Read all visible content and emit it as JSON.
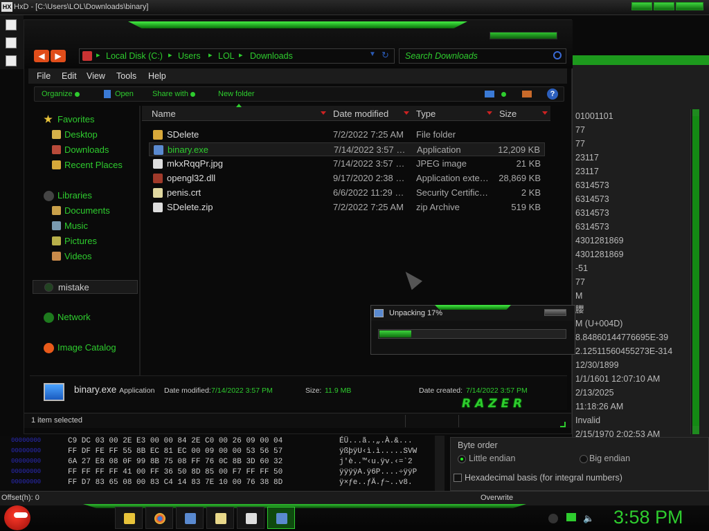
{
  "hxd": {
    "title": "HxD - [C:\\Users\\LOL\\Downloads\\binary]",
    "status_offset": "Offset(h): 0",
    "status_mode": "Overwrite",
    "hex_rows": [
      {
        "bytes": "C9 DC 03 00 2E E3 00 00 84 2E C0 00 26 09 00 04",
        "text": "ÉÜ...ã..„.À.&..."
      },
      {
        "bytes": "FF DF FE FF 55 8B EC 81 EC 00 09 00 00 53 56 57",
        "text": "ÿßþÿU‹ì.ì.....SVW"
      },
      {
        "bytes": "6A 27 E8 08 0F 99 8B 75 08 FF 76 0C 8B 3D 60 32",
        "text": "j'è..™‹u.ÿv.‹=`2"
      },
      {
        "bytes": "FF FF FF FF 41 00 FF 36 50 8D 85 00 F7 FF FF 50",
        "text": "ÿÿÿÿA.ÿ6P....÷ÿÿP"
      },
      {
        "bytes": "FF D7 83 65 08 00 83 C4 14 83 7E 10 00 76 38 8D",
        "text": "ÿ×ƒe..ƒÄ.ƒ~..v8."
      }
    ],
    "inspector_values": [
      "01001101",
      "77",
      "77",
      "23117",
      "23117",
      "6314573",
      "6314573",
      "6314573",
      "6314573",
      "4301281869",
      "4301281869",
      "-51",
      "77",
      "M",
      "䑍",
      "M (U+004D)",
      "8.84860144776695E-39",
      "2.12511560455273E-314",
      "12/30/1899",
      "1/1/1601 12:07:10 AM",
      "2/13/2025",
      "11:18:26 AM",
      "Invalid",
      "2/15/1970 2:02:53 AM"
    ],
    "byte_order_label": "Byte order",
    "little_endian": "Little endian",
    "big_endian": "Big endian",
    "hex_basis": "Hexadecimal basis (for integral numbers)"
  },
  "explorer": {
    "breadcrumb": [
      "Local Disk (C:)",
      "Users",
      "LOL",
      "Downloads"
    ],
    "search_placeholder": "Search Downloads",
    "menu": [
      "File",
      "Edit",
      "View",
      "Tools",
      "Help"
    ],
    "commands": {
      "organize": "Organize",
      "open": "Open",
      "share": "Share with",
      "new_folder": "New folder"
    },
    "nav": {
      "favorites": "Favorites",
      "desktop": "Desktop",
      "downloads": "Downloads",
      "recent": "Recent Places",
      "libraries": "Libraries",
      "documents": "Documents",
      "music": "Music",
      "pictures": "Pictures",
      "videos": "Videos",
      "mistake": "mistake",
      "network": "Network",
      "image_catalog": "Image Catalog"
    },
    "columns": {
      "name": "Name",
      "date": "Date modified",
      "type": "Type",
      "size": "Size"
    },
    "files": [
      {
        "name": "SDelete",
        "date": "7/2/2022 7:25 AM",
        "type": "File folder",
        "size": "",
        "color": "#d9a93a"
      },
      {
        "name": "binary.exe",
        "date": "7/14/2022 3:57 PM",
        "type": "Application",
        "size": "12,209 KB",
        "color": "#5a8ad0"
      },
      {
        "name": "mkxRqqPr.jpg",
        "date": "7/14/2022 3:57 PM",
        "type": "JPEG image",
        "size": "21 KB",
        "color": "#dddddd"
      },
      {
        "name": "opengl32.dll",
        "date": "9/17/2020 2:38 PM",
        "type": "Application extension",
        "size": "28,869 KB",
        "color": "#a03a2a"
      },
      {
        "name": "penis.crt",
        "date": "6/6/2022 11:29 PM",
        "type": "Security Certificate",
        "size": "2 KB",
        "color": "#e0d8a0"
      },
      {
        "name": "SDelete.zip",
        "date": "7/2/2022 7:25 AM",
        "type": "zip Archive",
        "size": "519 KB",
        "color": "#dddddd"
      }
    ],
    "unpack": {
      "title": "Unpacking 17%",
      "progress": 0.17
    },
    "details": {
      "name": "binary.exe",
      "type": "Application",
      "date_label": "Date modified:",
      "date": "7/14/2022 3:57 PM",
      "size_label": "Size:",
      "size": "11.9 MB",
      "created_label": "Date created:",
      "created": "7/14/2022 3:57 PM",
      "brand": "RAZER"
    },
    "status": "1 item selected"
  },
  "taskbar": {
    "clock": "3:58 PM"
  },
  "colors": {
    "accent": "#2ecc2e",
    "accent_dark": "#0f6d0f",
    "background": "#0a0a0a"
  }
}
